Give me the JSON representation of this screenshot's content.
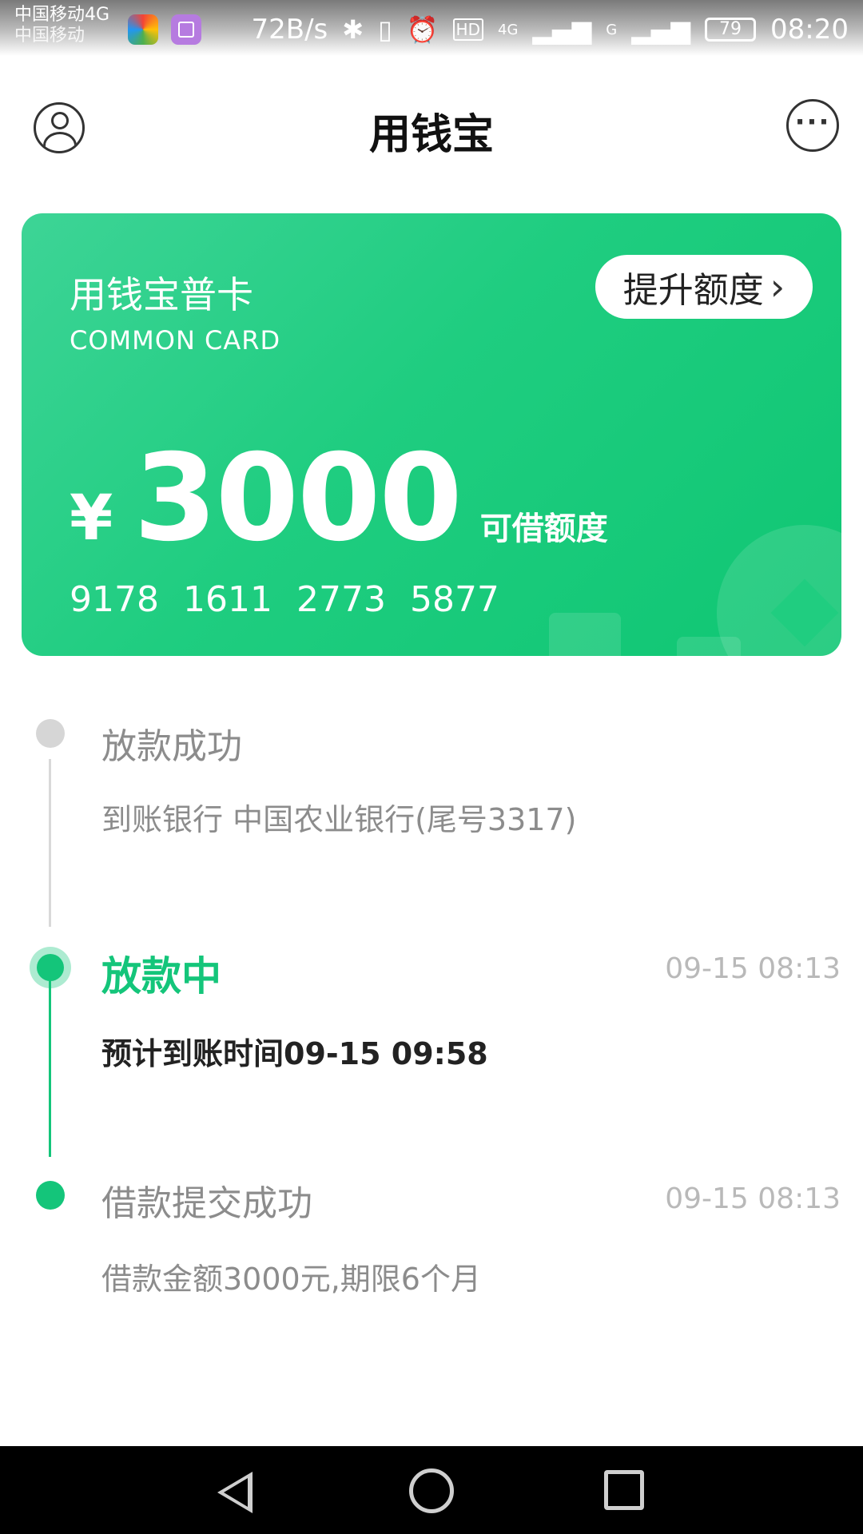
{
  "status_bar": {
    "carrier_primary": "中国移动4G",
    "carrier_secondary": "中国移动",
    "net_speed": "72B/s",
    "net_hd": "HD",
    "net_4g": "4G",
    "net_g": "G",
    "battery": "79",
    "time": "08:20"
  },
  "header": {
    "title": "用钱宝"
  },
  "card": {
    "name": "用钱宝普卡",
    "subtitle": "COMMON CARD",
    "raise_button_label": "提升额度",
    "currency_symbol": "¥",
    "amount": "3000",
    "amount_label": "可借额度",
    "number_groups": [
      "9178",
      "1611",
      "2773",
      "5877"
    ],
    "colors": {
      "gradient_start": "#3dd496",
      "gradient_end": "#0fc673"
    }
  },
  "timeline": {
    "steps": [
      {
        "title": "放款成功",
        "detail": "到账银行 中国农业银行(尾号3317)",
        "time": "",
        "state": "pending"
      },
      {
        "title": "放款中",
        "detail": "预计到账时间09-15 09:58",
        "time": "09-15 08:13",
        "state": "active"
      },
      {
        "title": "借款提交成功",
        "detail": "借款金额3000元,期限6个月",
        "time": "09-15 08:13",
        "state": "done"
      }
    ],
    "accent_color": "#14c57a"
  }
}
